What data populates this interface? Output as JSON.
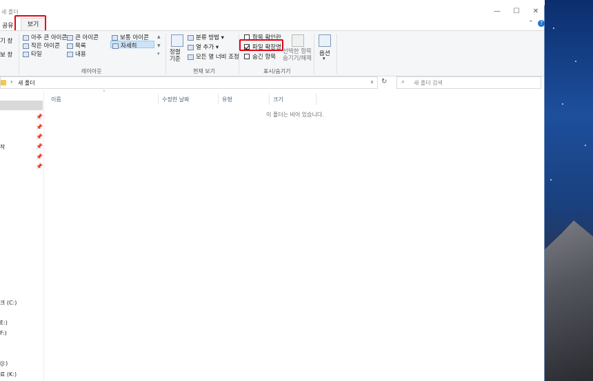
{
  "window": {
    "title": "새 폴더",
    "minimize": "—",
    "maximize": "☐",
    "close": "✕"
  },
  "tabs": {
    "share": "공유",
    "view": "보기",
    "collapse": "⌃",
    "help": "?"
  },
  "ribbon": {
    "pane_partial1": "기 창",
    "pane_partial2": "보 창",
    "layout": {
      "items": [
        "아주 큰 아이콘",
        "큰 아이콘",
        "보통 아이콘",
        "작은 아이콘",
        "목록",
        "자세히",
        "타일",
        "내용"
      ],
      "group_label": "레이아웃"
    },
    "current_view": {
      "sort_by": "정렬\n기준",
      "group_by": "분류 방법 ▾",
      "add_columns": "열 추가 ▾",
      "fit_columns": "모든 열 너비 조정",
      "group_label": "현재 보기"
    },
    "show_hide": {
      "item_checkboxes": "항목 확인란",
      "file_extensions": "파일 확장명",
      "hidden_items": "숨긴 항목",
      "hide_selected": "선택한 항목\n숨기기/해제",
      "group_label": "표시/숨기기",
      "item_checkboxes_checked": false,
      "file_extensions_checked": true,
      "hidden_items_checked": false
    },
    "options": "옵션"
  },
  "address": {
    "path": "새 폴더",
    "search_placeholder": "새 폴더 검색"
  },
  "nav": {
    "items": [
      "크 (C:)",
      "E:)",
      "F:)",
      "(J:)",
      "료 (K:)",
      "작"
    ]
  },
  "columns": [
    "이름",
    "수정한 날짜",
    "유형",
    "크기"
  ],
  "empty_message": "이 폴더는 비어 있습니다."
}
